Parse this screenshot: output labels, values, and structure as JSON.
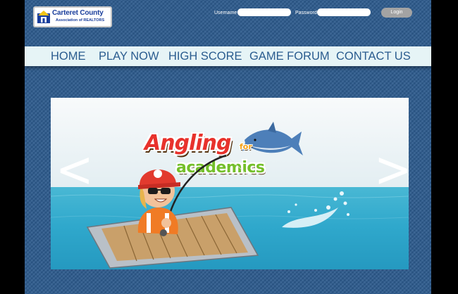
{
  "site": {
    "logo_name": "Carteret County",
    "logo_subtitle": "Association of REALTORS"
  },
  "login": {
    "username_label": "Username",
    "password_label": "Password",
    "button_label": "Login"
  },
  "nav": {
    "items": [
      "HOME",
      "PLAY NOW",
      "HIGH SCORE",
      "GAME FORUM",
      "CONTACT US"
    ]
  },
  "banner": {
    "title_main": "Angling",
    "title_connector": "for",
    "title_sub": "academics",
    "prev_icon": "chevron-left-icon",
    "next_icon": "chevron-right-icon"
  },
  "colors": {
    "page_bg": "#2c5a8c",
    "nav_bg": "#e6f4f6",
    "nav_text": "#2a5c8f",
    "login_button": "#a3a3a3",
    "title_red": "#e8322c",
    "title_green": "#74bf2a",
    "title_orange": "#f5a116"
  }
}
